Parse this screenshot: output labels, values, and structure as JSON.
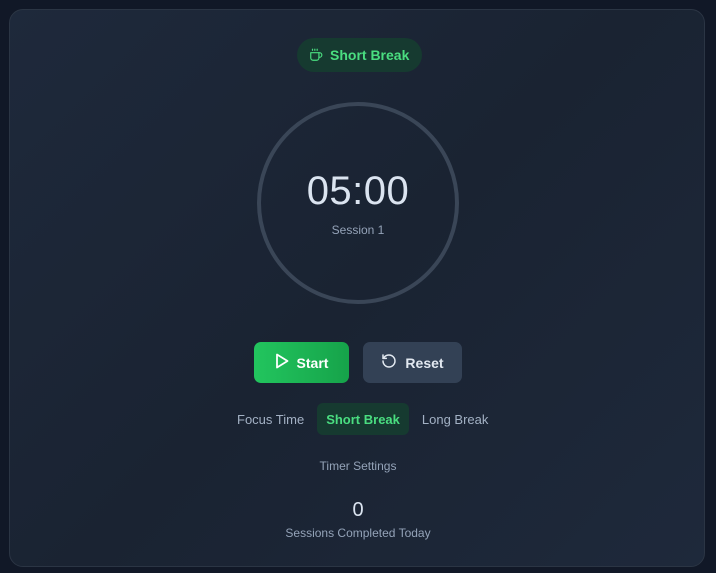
{
  "mode_badge": {
    "label": "Short Break",
    "icon": "coffee-cup-icon"
  },
  "timer": {
    "time": "05:00",
    "session_label": "Session 1"
  },
  "controls": {
    "start_label": "Start",
    "start_icon": "play-icon",
    "reset_label": "Reset",
    "reset_icon": "reset-icon"
  },
  "mode_tabs": [
    {
      "label": "Focus Time",
      "active": false
    },
    {
      "label": "Short Break",
      "active": true
    },
    {
      "label": "Long Break",
      "active": false
    }
  ],
  "settings": {
    "label": "Timer Settings"
  },
  "stats": {
    "sessions_count": "0",
    "sessions_label": "Sessions Completed Today"
  },
  "colors": {
    "accent": "#4ade80",
    "start_button": "#22c55e",
    "reset_button": "#334155",
    "ring": "#3a4657",
    "card": "#1e293b"
  }
}
